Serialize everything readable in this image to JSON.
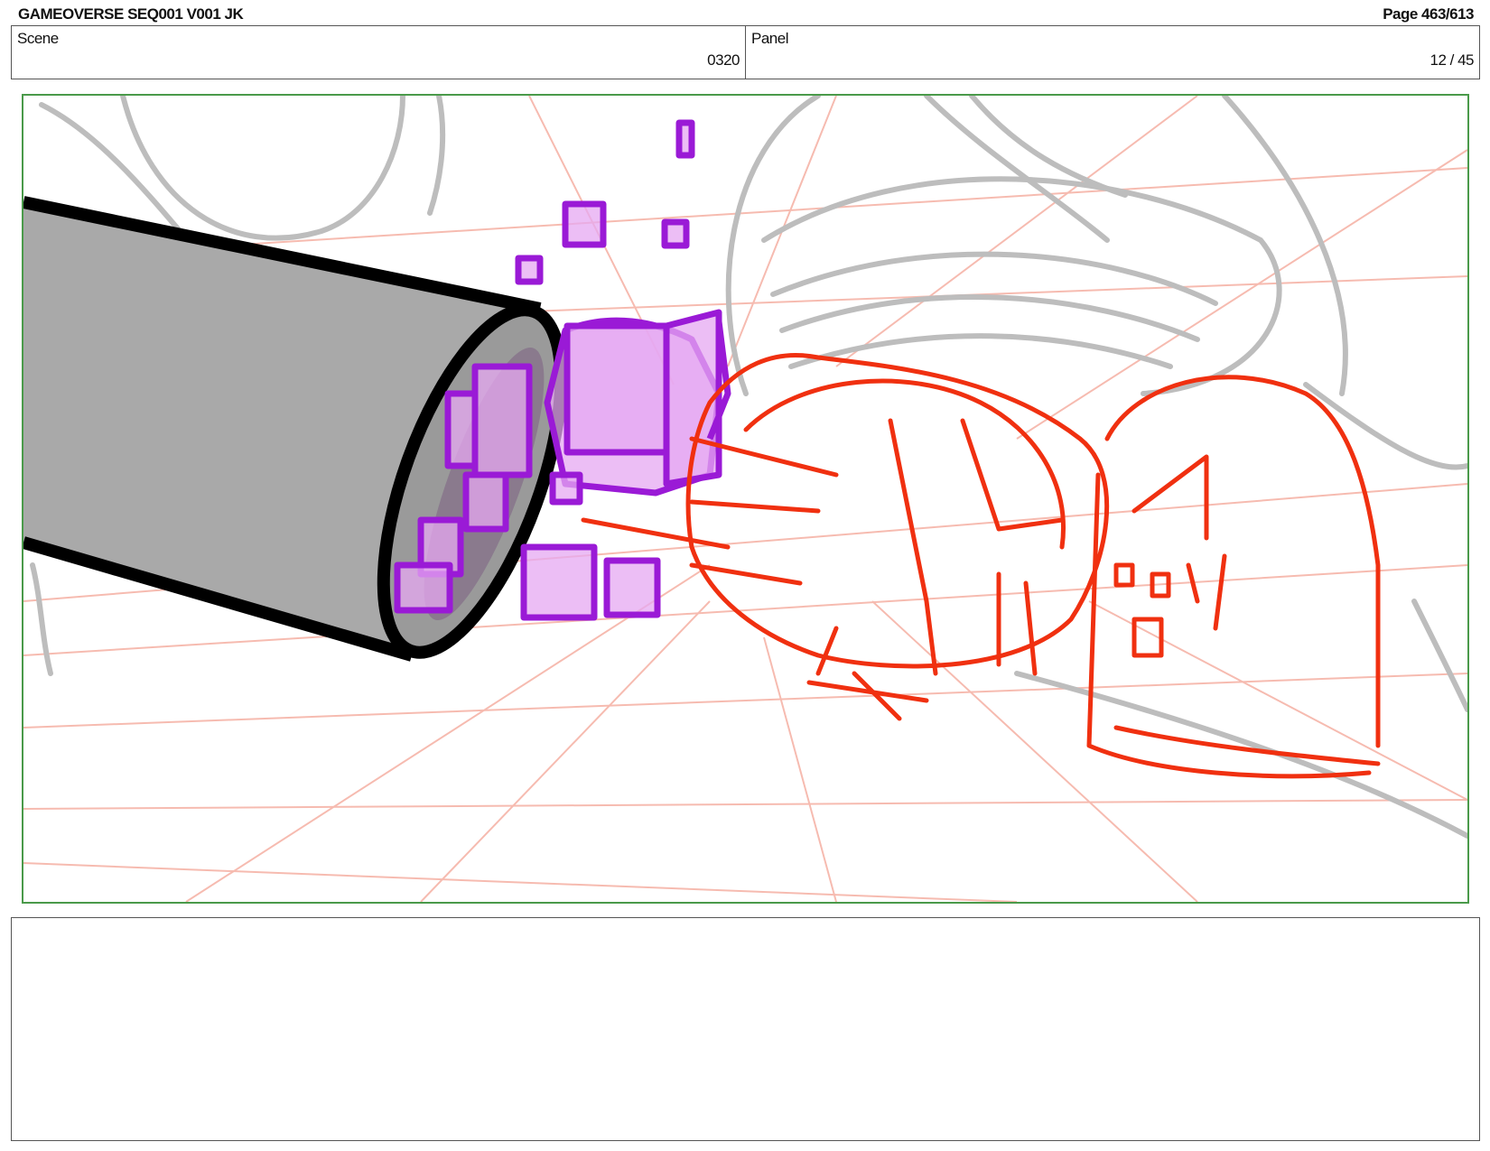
{
  "header": {
    "document_title": "GAMEOVERSE SEQ001 V001 JK",
    "page_label": "Page 463/613"
  },
  "info": {
    "scene_label": "Scene",
    "scene_value": "0320",
    "panel_label": "Panel",
    "panel_value": "12 / 45"
  },
  "panel_image": {
    "colors": {
      "frame": "#4a9a4a",
      "perspective_grid": "#f6b4a8",
      "background_sketch": "#bdbdbd",
      "tube_fill": "#a9a9a9",
      "tube_outline": "#000000",
      "cubes": "#9a1ad6",
      "cube_fill": "#e6a8f2",
      "sketch_red": "#f03010"
    }
  },
  "notes": {
    "text": ""
  }
}
